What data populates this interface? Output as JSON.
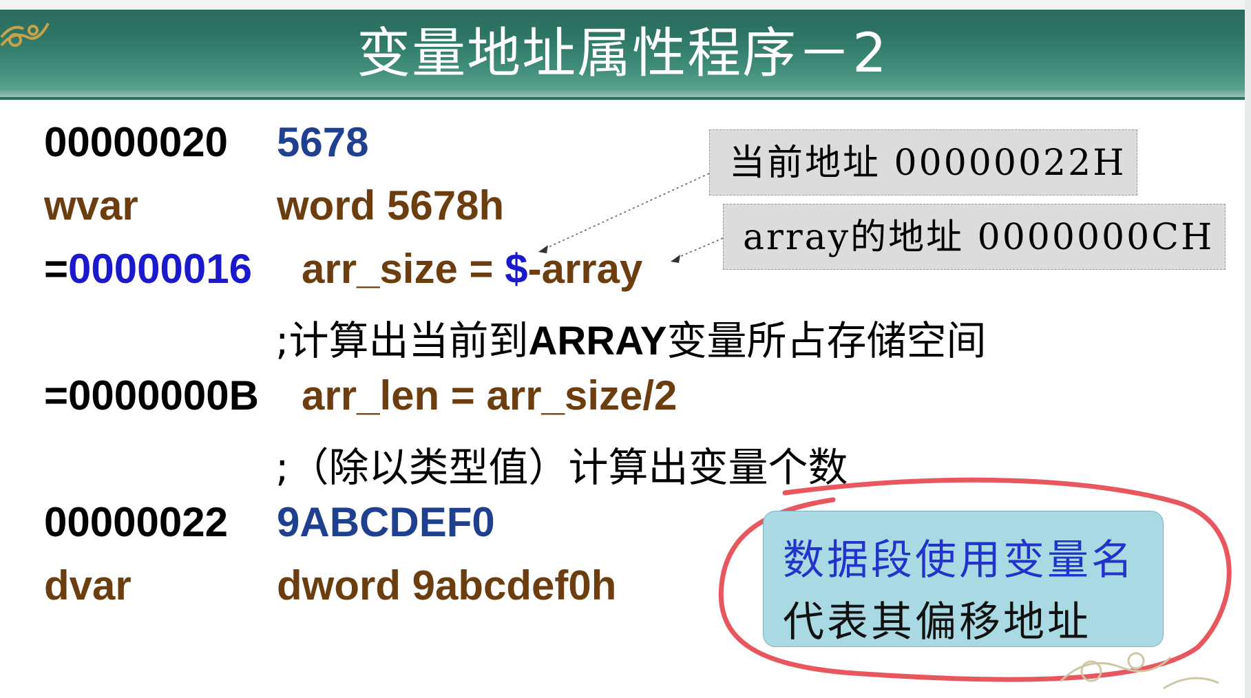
{
  "slide": {
    "title": "变量地址属性程序－2"
  },
  "code": {
    "r1_addr": "00000020",
    "r1_value": "5678",
    "r2_name": "wvar",
    "r2_decl": "word 5678h",
    "r3_eq": "=",
    "r3_value": "00000016",
    "r3_stmt_a": "arr_size = ",
    "r3_dollar": "$",
    "r3_stmt_b": "-array",
    "r4_comment_a": ";计算出当前到",
    "r4_comment_b": "ARRAY",
    "r4_comment_c": "变量所占存储空间",
    "r5_value": "=0000000B",
    "r5_stmt": "arr_len = arr_size/2",
    "r6_comment": ";（除以类型值）计算出变量个数",
    "r7_addr": "00000022",
    "r7_value": "9ABCDEF0",
    "r8_name": "dvar",
    "r8_decl": "dword 9abcdef0h"
  },
  "callouts": {
    "current_address": "当前地址  00000022H",
    "array_address": "array的地址  0000000CH"
  },
  "note": {
    "line1": "数据段使用变量名",
    "line2": "代表其偏移地址"
  },
  "colors": {
    "header": "#2e7565",
    "address_black": "#000000",
    "value_blue": "#1f3f8f",
    "vivid_blue": "#1a1acc",
    "code_brown": "#6b3d0f",
    "note_bg": "#a9d9e2",
    "annotation_red": "#e8565e"
  }
}
